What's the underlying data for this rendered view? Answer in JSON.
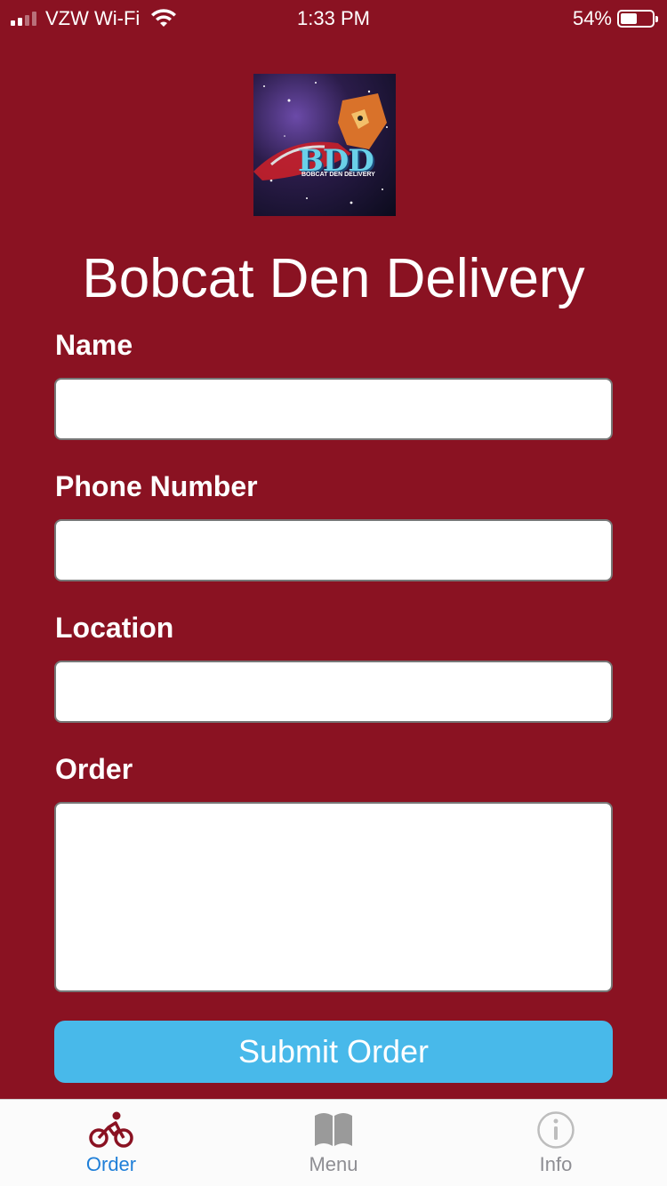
{
  "status_bar": {
    "carrier": "VZW Wi-Fi",
    "time": "1:33 PM",
    "battery_percent": "54%",
    "battery_level": 0.54
  },
  "logo": {
    "text": "BDD",
    "subtext": "BOBCAT DEN DELIVERY"
  },
  "app_title": "Bobcat Den Delivery",
  "form": {
    "name_label": "Name",
    "name_value": "",
    "phone_label": "Phone Number",
    "phone_value": "",
    "location_label": "Location",
    "location_value": "",
    "order_label": "Order",
    "order_value": "",
    "submit_label": "Submit Order"
  },
  "tabs": [
    {
      "label": "Order",
      "icon": "bicycle-icon",
      "active": true
    },
    {
      "label": "Menu",
      "icon": "book-icon",
      "active": false
    },
    {
      "label": "Info",
      "icon": "info-icon",
      "active": false
    }
  ],
  "colors": {
    "background": "#8a1222",
    "submit_button": "#48b9ea",
    "active_tab": "#1f7fd8",
    "inactive_tab": "#8e8e93"
  }
}
